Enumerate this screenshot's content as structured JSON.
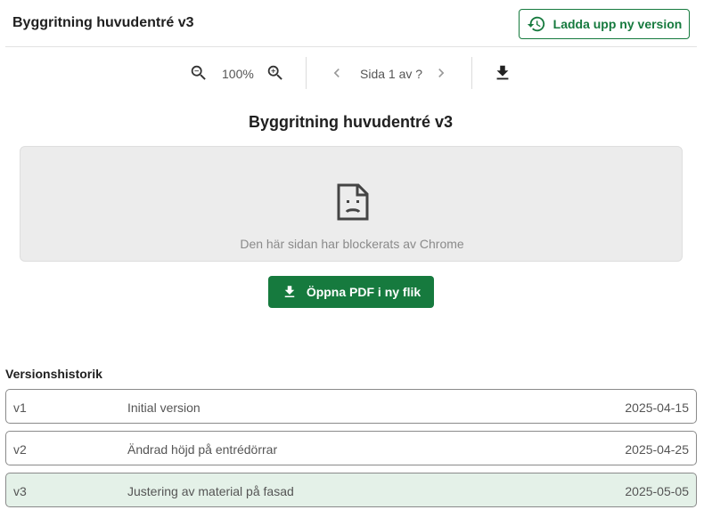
{
  "header": {
    "title": "Byggritning huvudentré v3",
    "upload_label": "Ladda upp ny version"
  },
  "toolbar": {
    "zoom": "100%",
    "page_indicator": "Sida 1 av ?",
    "icons": [
      "zoom-out-icon",
      "zoom-in-icon",
      "chevron-left-icon",
      "chevron-right-icon",
      "download-icon"
    ]
  },
  "document": {
    "title": "Byggritning huvudentré v3",
    "blocked_message": "Den här sidan har blockerats av Chrome",
    "open_pdf_label": "Öppna PDF i ny flik"
  },
  "versions": {
    "heading": "Versionshistorik",
    "items": [
      {
        "id": "v1",
        "description": "Initial version",
        "date": "2025-04-15"
      },
      {
        "id": "v2",
        "description": "Ändrad höjd på entrédörrar",
        "date": "2025-04-25"
      },
      {
        "id": "v3",
        "description": "Justering av material på fasad",
        "date": "2025-05-05"
      }
    ],
    "active": "v3"
  },
  "colors": {
    "accent": "#167a3e",
    "active_row": "#e4f1e8",
    "blocked_bg": "#ececec"
  }
}
